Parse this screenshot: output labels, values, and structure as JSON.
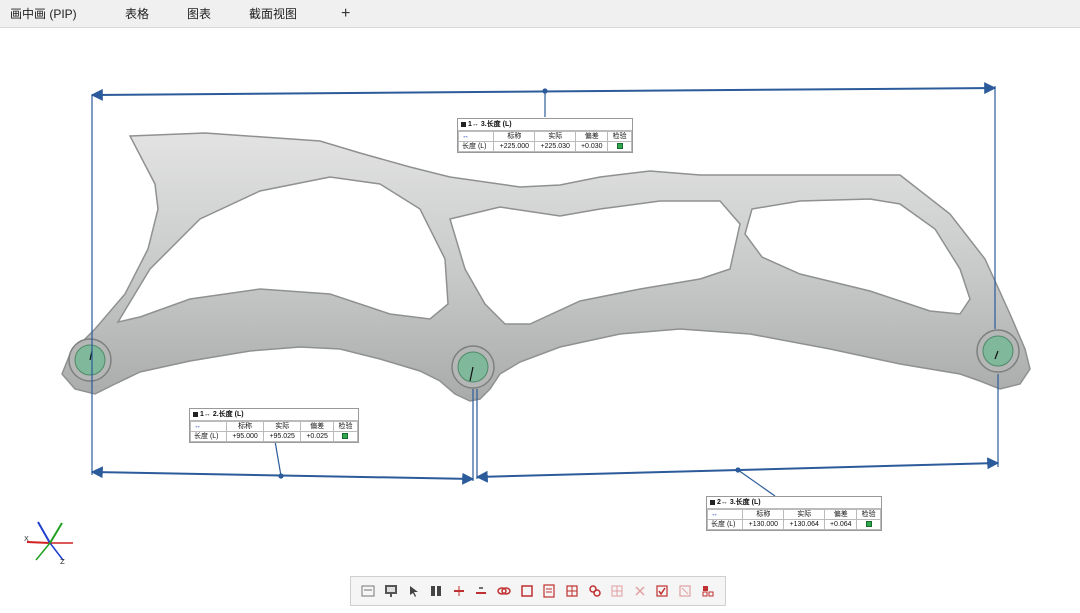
{
  "tabs": [
    {
      "label": "画中画 (PIP)"
    },
    {
      "label": "表格"
    },
    {
      "label": "图表"
    },
    {
      "label": "截面视图"
    }
  ],
  "add_tab_label": "+",
  "labels": [
    {
      "title": "1↔ 3.长度 (L)",
      "headers": [
        "",
        "标称",
        "实际",
        "偏差",
        "检验"
      ],
      "row": {
        "name": "长度 (L)",
        "nominal": "+225.000",
        "actual": "+225.030",
        "deviation": "+0.030",
        "status": "pass"
      }
    },
    {
      "title": "1↔ 2.长度 (L)",
      "headers": [
        "",
        "标称",
        "实际",
        "偏差",
        "检验"
      ],
      "row": {
        "name": "长度 (L)",
        "nominal": "+95.000",
        "actual": "+95.025",
        "deviation": "+0.025",
        "status": "pass"
      }
    },
    {
      "title": "2↔ 3.长度 (L)",
      "headers": [
        "",
        "标称",
        "实际",
        "偏差",
        "检验"
      ],
      "row": {
        "name": "长度 (L)",
        "nominal": "+130.000",
        "actual": "+130.064",
        "deviation": "+0.064",
        "status": "pass"
      }
    }
  ],
  "axis_labels": {
    "x": "X",
    "z": "Z"
  },
  "colors": {
    "dimension_line": "#2b5b9a",
    "part_fill": "#c9cbca",
    "hole_fill": "#7fb89a",
    "pass": "#2fa84f",
    "axis_x": "#d02020",
    "axis_y": "#20a020",
    "axis_z": "#2040d0"
  },
  "toolbar": {
    "tools": [
      "properties-icon",
      "monitor-icon",
      "select-icon",
      "split-view-icon",
      "dimension-icon",
      "measure-icon",
      "link-icon",
      "square-icon",
      "report-icon",
      "table-icon",
      "chain-icon",
      "grid-icon",
      "close-x-icon",
      "check-icon",
      "cancel-icon",
      "settings-icon"
    ]
  }
}
